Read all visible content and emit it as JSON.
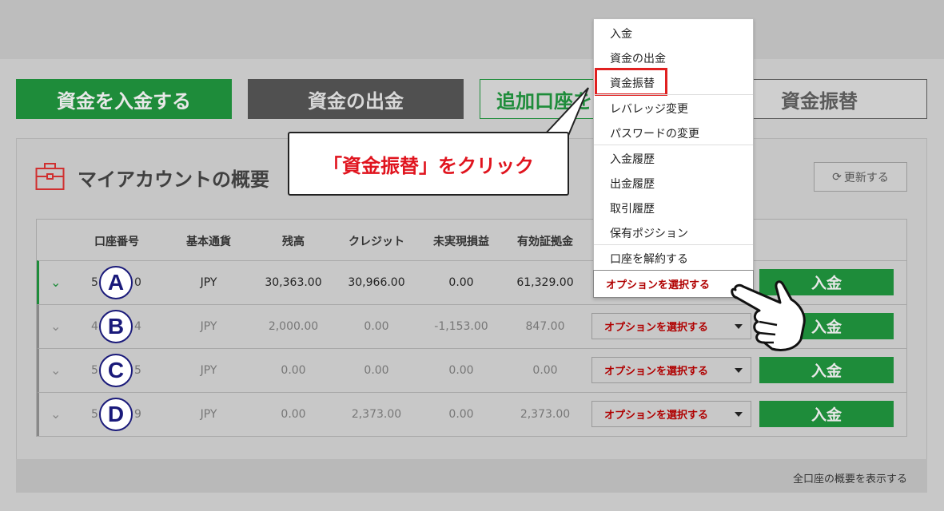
{
  "top_buttons": {
    "deposit": "資金を入金する",
    "withdraw": "資金の出金",
    "additional": "追加口座を",
    "transfer": "資金振替"
  },
  "panel": {
    "title": "マイアカウントの概要",
    "refresh": "更新する",
    "footer_link": "全口座の概要を表示する"
  },
  "table": {
    "headers": [
      "口座番号",
      "基本通貨",
      "残高",
      "クレジット",
      "未実現損益",
      "有効証拠金"
    ],
    "rows": [
      {
        "marker": "A",
        "acct_prefix": "5",
        "acct_suffix": "0",
        "currency": "JPY",
        "balance": "30,363.00",
        "credit": "30,966.00",
        "unrealized": "0.00",
        "equity": "61,329.00",
        "option": "オプションを選択する",
        "deposit": "入金"
      },
      {
        "marker": "B",
        "acct_prefix": "4",
        "acct_suffix": "4",
        "currency": "JPY",
        "balance": "2,000.00",
        "credit": "0.00",
        "unrealized": "-1,153.00",
        "equity": "847.00",
        "option": "オプションを選択する",
        "deposit": "入金"
      },
      {
        "marker": "C",
        "acct_prefix": "5",
        "acct_suffix": "5",
        "currency": "JPY",
        "balance": "0.00",
        "credit": "0.00",
        "unrealized": "0.00",
        "equity": "0.00",
        "option": "オプションを選択する",
        "deposit": "入金"
      },
      {
        "marker": "D",
        "acct_prefix": "5",
        "acct_suffix": "9",
        "currency": "JPY",
        "balance": "0.00",
        "credit": "2,373.00",
        "unrealized": "0.00",
        "equity": "2,373.00",
        "option": "オプションを選択する",
        "deposit": "入金"
      }
    ]
  },
  "dropdown": {
    "items": [
      "入金",
      "資金の出金",
      "資金振替",
      "レバレッジ変更",
      "パスワードの変更",
      "入金履歴",
      "出金履歴",
      "取引履歴",
      "保有ポジション",
      "口座を解約する"
    ],
    "selected": "オプションを選択する"
  },
  "callout": {
    "text": "「資金振替」をクリック"
  },
  "colors": {
    "green": "#1e8c3a",
    "dark": "#505050",
    "red": "#e0141e",
    "navy": "#1a1a7a"
  }
}
